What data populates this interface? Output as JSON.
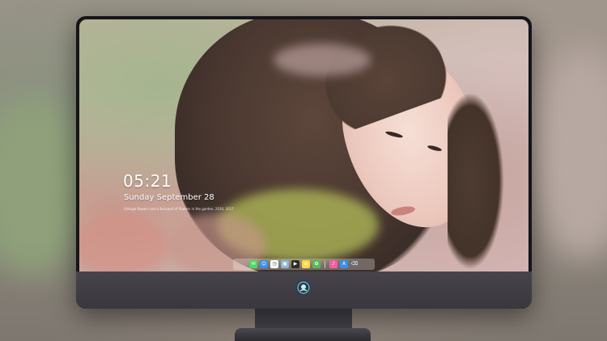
{
  "lockscreen": {
    "time": "05:21",
    "date": "Sunday September  28",
    "caption": "Vintage flowers and a bouquet of flowers in the garden, 2016, 2017"
  },
  "dock": {
    "icons": [
      {
        "name": "messages-icon",
        "color": "#4cd964",
        "glyph": "✉"
      },
      {
        "name": "finder-icon",
        "color": "#3b8ee8",
        "glyph": "☺"
      },
      {
        "name": "clock-icon",
        "color": "#ffffff",
        "glyph": "◷"
      },
      {
        "name": "preview-icon",
        "color": "#8bb7d6",
        "glyph": "▣"
      },
      {
        "name": "video-icon",
        "color": "#2c2c2c",
        "glyph": "▶"
      },
      {
        "name": "notes-icon",
        "color": "#ffd84a",
        "glyph": "≡"
      },
      {
        "name": "photos-icon",
        "color": "#5cb85c",
        "glyph": "✿"
      },
      {
        "name": "music-icon",
        "color": "#f25ea0",
        "glyph": "♪"
      },
      {
        "name": "appstore-icon",
        "color": "#3b8ee8",
        "glyph": "A"
      },
      {
        "name": "trash-icon",
        "color": "#6b6b70",
        "glyph": "⌫"
      }
    ]
  },
  "colors": {
    "bezel": "#15151a",
    "chin": "#3a383e",
    "logo": "#5ec8e6"
  }
}
